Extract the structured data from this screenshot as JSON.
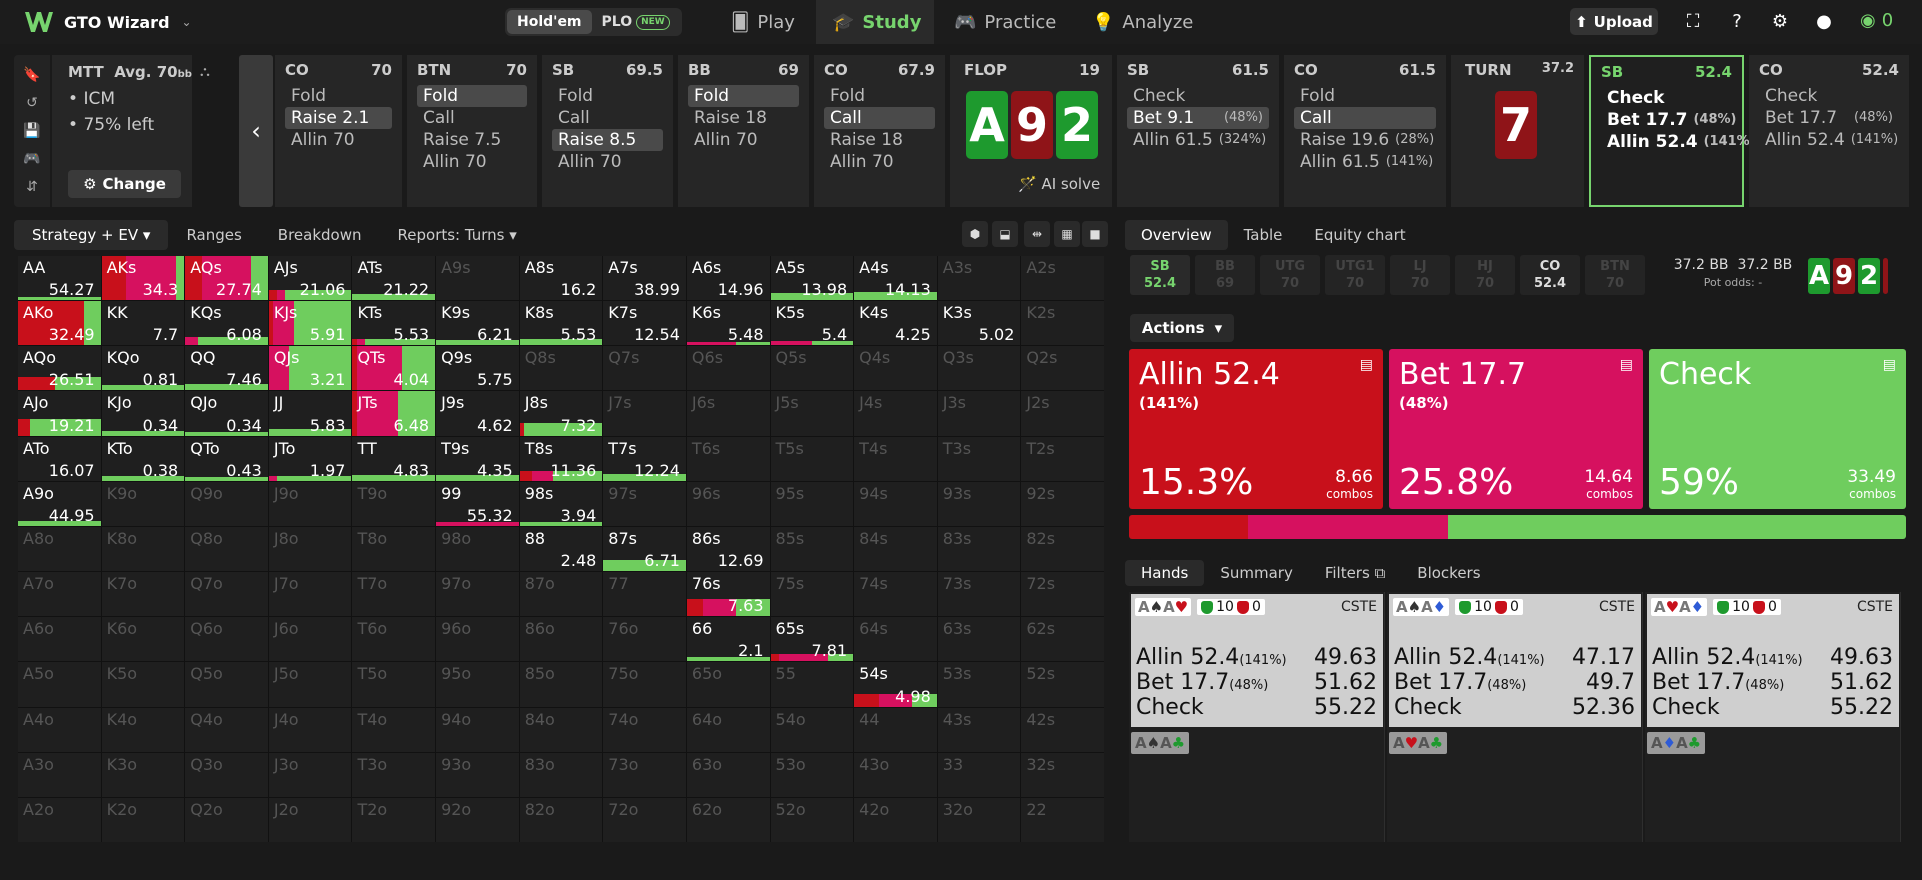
{
  "header": {
    "app_name": "GTO Wizard",
    "holdem": "Hold'em",
    "plo": "PLO",
    "new_badge": "NEW",
    "nav": [
      "Play",
      "Study",
      "Practice",
      "Analyze"
    ],
    "upload": "Upload",
    "coins": "0"
  },
  "mtt": {
    "title": "MTT",
    "avg": "Avg. 70",
    "avg_unit": "bb",
    "bullets": [
      "ICM",
      "75% left"
    ],
    "change": "Change"
  },
  "preflop": [
    {
      "pos": "CO",
      "stack": "70",
      "actions": [
        {
          "l": "Fold"
        },
        {
          "l": "Raise 2.1",
          "sel": true
        },
        {
          "l": "Allin 70"
        }
      ]
    },
    {
      "pos": "BTN",
      "stack": "70",
      "actions": [
        {
          "l": "Fold",
          "sel": true
        },
        {
          "l": "Call"
        },
        {
          "l": "Raise 7.5"
        },
        {
          "l": "Allin 70"
        }
      ]
    },
    {
      "pos": "SB",
      "stack": "69.5",
      "actions": [
        {
          "l": "Fold"
        },
        {
          "l": "Call"
        },
        {
          "l": "Raise 8.5",
          "sel": true
        },
        {
          "l": "Allin 70"
        }
      ]
    },
    {
      "pos": "BB",
      "stack": "69",
      "actions": [
        {
          "l": "Fold",
          "sel": true
        },
        {
          "l": "Raise 18"
        },
        {
          "l": "Allin 70"
        }
      ]
    },
    {
      "pos": "CO",
      "stack": "67.9",
      "actions": [
        {
          "l": "Fold"
        },
        {
          "l": "Call",
          "sel": true
        },
        {
          "l": "Raise 18"
        },
        {
          "l": "Allin 70"
        }
      ]
    }
  ],
  "flop": {
    "label": "FLOP",
    "pot": "19",
    "cards": [
      "A",
      "9",
      "2"
    ],
    "ai_solve": "AI solve"
  },
  "flop_actions": [
    {
      "pos": "SB",
      "stack": "61.5",
      "actions": [
        {
          "l": "Check"
        },
        {
          "l": "Bet 9.1",
          "p": "(48%)",
          "sel": true
        },
        {
          "l": "Allin 61.5",
          "p": "(324%)"
        }
      ]
    },
    {
      "pos": "CO",
      "stack": "61.5",
      "actions": [
        {
          "l": "Fold"
        },
        {
          "l": "Call",
          "sel": true
        },
        {
          "l": "Raise 19.6",
          "p": "(28%)"
        },
        {
          "l": "Allin 61.5",
          "p": "(141%)"
        }
      ]
    }
  ],
  "turn": {
    "label": "TURN",
    "pot": "37.2",
    "card": "7"
  },
  "turn_actions": [
    {
      "pos": "SB",
      "stack": "52.4",
      "cur": true,
      "actions": [
        {
          "l": "Check"
        },
        {
          "l": "Bet 17.7",
          "p": "(48%)"
        },
        {
          "l": "Allin 52.4",
          "p": "(141%)"
        }
      ]
    },
    {
      "pos": "CO",
      "stack": "52.4",
      "actions": [
        {
          "l": "Check"
        },
        {
          "l": "Bet 17.7",
          "p": "(48%)"
        },
        {
          "l": "Allin 52.4",
          "p": "(141%)"
        }
      ]
    }
  ],
  "left_tabs": [
    "Strategy + EV",
    "Ranges",
    "Breakdown",
    "Reports: Turns"
  ],
  "grid_rows": [
    [
      "AA|54.27|0:0:100",
      "AKs|34.3|30:60:10",
      "AQs|27.74|20:60:20",
      "AJs|21.06|10:10:80",
      "ATs|21.22|0:0:100",
      "A9s",
      "A8s|16.2",
      "A7s|38.99",
      "A6s|14.96",
      "A5s|13.98|0:0:100",
      "A4s|14.13|0:0:100",
      "A3s",
      "A2s"
    ],
    [
      "AKo|32.49|80:0:20",
      "KK|7.7",
      "KQs|6.08|0:15:85",
      "KJs|5.91|5:25:70",
      "KTs|5.53|5:10:85",
      "K9s|6.21|0:0:100",
      "K8s|5.53|0:0:100",
      "K7s|12.54",
      "K6s|5.48|0:60:40",
      "K5s|5.4|0:50:50",
      "K4s|4.25",
      "K3s|5.02",
      "K2s"
    ],
    [
      "AQo|26.51|45:0:55",
      "KQo|0.81|0:0:100",
      "QQ|7.46|0:0:100",
      "QJs|3.21|0:25:75",
      "QTs|4.04|5:55:40",
      "Q9s|5.75",
      "Q8s",
      "Q7s",
      "Q6s",
      "Q5s",
      "Q4s",
      "Q3s",
      "Q2s"
    ],
    [
      "AJo|19.21|15:0:85",
      "KJo|0.34|0:0:100",
      "QJo|0.34|0:0:100",
      "JJ|5.83|0:0:100",
      "JTs|6.48|5:50:45",
      "J9s|4.62",
      "J8s|7.32|5:0:95",
      "J7s",
      "J6s",
      "J5s",
      "J4s",
      "J3s",
      "J2s"
    ],
    [
      "ATo|16.07",
      "KTo|0.38|0:0:100",
      "QTo|0.43|0:0:100",
      "JTo|1.97|0:10:90",
      "TT|4.83|0:0:100",
      "T9s|4.35|0:0:100",
      "T8s|11.36|15:25:60",
      "T7s|12.24|0:0:100",
      "T6s",
      "T5s",
      "T4s",
      "T3s",
      "T2s"
    ],
    [
      "A9o|44.95|0:0:100",
      "K9o",
      "Q9o",
      "J9o",
      "T9o",
      "99|55.32|0:100:0",
      "98s|3.94|0:0:100",
      "97s",
      "96s",
      "95s",
      "94s",
      "93s",
      "92s"
    ],
    [
      "A8o",
      "K8o",
      "Q8o",
      "J8o",
      "T8o",
      "98o",
      "88|2.48",
      "87s|6.71|0:0:100",
      "86s|12.69",
      "85s",
      "84s",
      "83s",
      "82s"
    ],
    [
      "A7o",
      "K7o",
      "Q7o",
      "J7o",
      "T7o",
      "97o",
      "87o",
      "77",
      "76s|7.63|20:40:40",
      "75s",
      "74s",
      "73s",
      "72s"
    ],
    [
      "A6o",
      "K6o",
      "Q6o",
      "J6o",
      "T6o",
      "96o",
      "86o",
      "76o",
      "66|2.1|0:0:100",
      "65s|7.81|10:60:30",
      "64s",
      "63s",
      "62s"
    ],
    [
      "A5o",
      "K5o",
      "Q5o",
      "J5o",
      "T5o",
      "95o",
      "85o",
      "75o",
      "65o",
      "55",
      "54s|4.98|30:40:30",
      "53s",
      "52s"
    ],
    [
      "A4o",
      "K4o",
      "Q4o",
      "J4o",
      "T4o",
      "94o",
      "84o",
      "74o",
      "64o",
      "54o",
      "44",
      "43s",
      "42s"
    ],
    [
      "A3o",
      "K3o",
      "Q3o",
      "J3o",
      "T3o",
      "93o",
      "83o",
      "73o",
      "63o",
      "53o",
      "43o",
      "33",
      "32s"
    ],
    [
      "A2o",
      "K2o",
      "Q2o",
      "J2o",
      "T2o",
      "92o",
      "82o",
      "72o",
      "62o",
      "52o",
      "42o",
      "32o",
      "22"
    ]
  ],
  "grid_bar_heights": {
    "AKs": 100,
    "AQs": 100,
    "AJs": 22,
    "ATs": 14,
    "A5s": 16,
    "A4s": 18,
    "AKo": 100,
    "KQs": 18,
    "KJs": 100,
    "KTs": 14,
    "K9s": 12,
    "K8s": 14,
    "K6s": 8,
    "K5s": 10,
    "AQo": 30,
    "KQo": 12,
    "QQ": 14,
    "QJs": 100,
    "QTs": 100,
    "AJo": 38,
    "KJo": 10,
    "QJo": 8,
    "JJ": 14,
    "JTs": 100,
    "J8s": 28,
    "KTo": 10,
    "QTo": 8,
    "JTo": 10,
    "TT": 12,
    "T9s": 12,
    "T8s": 22,
    "T7s": 16,
    "A9o": 12,
    "99": 8,
    "98s": 8,
    "87s": 24,
    "76s": 40,
    "66": 10,
    "65s": 16,
    "54s": 28,
    "AA": 8
  },
  "right_tabs": [
    "Overview",
    "Table",
    "Equity chart"
  ],
  "positions": [
    {
      "n": "SB",
      "v": "52.4",
      "s": "act"
    },
    {
      "n": "BB",
      "v": "69"
    },
    {
      "n": "UTG",
      "v": "70"
    },
    {
      "n": "UTG1",
      "v": "70"
    },
    {
      "n": "LJ",
      "v": "70"
    },
    {
      "n": "HJ",
      "v": "70"
    },
    {
      "n": "CO",
      "v": "52.4",
      "s": "w"
    },
    {
      "n": "BTN",
      "v": "70"
    }
  ],
  "pot": {
    "a": "37.2 BB",
    "b": "37.2 BB",
    "odds": "Pot odds:  -"
  },
  "board_small": [
    "A",
    "9",
    "2",
    "7"
  ],
  "actions_label": "Actions",
  "action_boxes": [
    {
      "title": "Allin 52.4",
      "sub": "(141%)",
      "pct": "15.3%",
      "combos": "8.66",
      "color": "#c8101b"
    },
    {
      "title": "Bet 17.7",
      "sub": "(48%)",
      "pct": "25.8%",
      "combos": "14.64",
      "color": "#d6115f"
    },
    {
      "title": "Check",
      "sub": "",
      "pct": "59%",
      "combos": "33.49",
      "color": "#6fcd5e"
    }
  ],
  "combos_word": "combos",
  "freq": [
    15.3,
    25.8,
    58.9
  ],
  "hands_tabs": [
    "Hands",
    "Summary",
    "Filters",
    "Blockers"
  ],
  "hands": [
    {
      "c1": "A",
      "s1": "♠",
      "c2": "A",
      "s2": "♥",
      "cnt1": "10",
      "cnt2": "0",
      "cste": "CSTE",
      "rows": [
        [
          "Allin 52.4",
          "(141%)",
          "49.63"
        ],
        [
          "Bet 17.7",
          "(48%)",
          "51.62"
        ],
        [
          "Check",
          "",
          "55.22"
        ]
      ],
      "b": [
        "A",
        "♠",
        "A",
        "♣"
      ]
    },
    {
      "c1": "A",
      "s1": "♠",
      "c2": "A",
      "s2": "♦",
      "cnt1": "10",
      "cnt2": "0",
      "cste": "CSTE",
      "rows": [
        [
          "Allin 52.4",
          "(141%)",
          "47.17"
        ],
        [
          "Bet 17.7",
          "(48%)",
          "49.7"
        ],
        [
          "Check",
          "",
          "52.36"
        ]
      ],
      "b": [
        "A",
        "♥",
        "A",
        "♣"
      ]
    },
    {
      "c1": "A",
      "s1": "♥",
      "c2": "A",
      "s2": "♦",
      "cnt1": "10",
      "cnt2": "0",
      "cste": "CSTE",
      "rows": [
        [
          "Allin 52.4",
          "(141%)",
          "49.63"
        ],
        [
          "Bet 17.7",
          "(48%)",
          "51.62"
        ],
        [
          "Check",
          "",
          "55.22"
        ]
      ],
      "b": [
        "A",
        "♦",
        "A",
        "♣"
      ]
    }
  ],
  "colors": {
    "allin": "#c8101b",
    "bet": "#d6115f",
    "check": "#6fcd5e",
    "accent": "#77d46e"
  }
}
